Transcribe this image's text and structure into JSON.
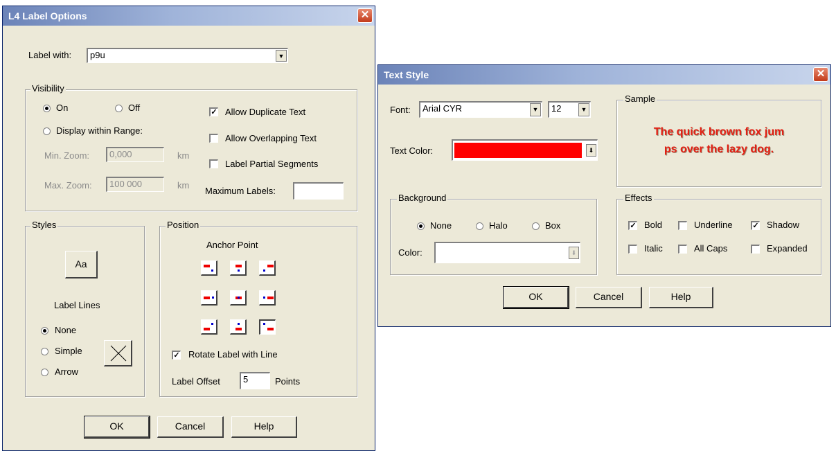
{
  "label_dialog": {
    "title": "L4 Label Options",
    "close_glyph": "✕",
    "label_with_label": "Label with:",
    "label_with_value": "p9u",
    "visibility": {
      "legend": "Visibility",
      "on_label": "On",
      "on_selected": true,
      "off_label": "Off",
      "off_selected": false,
      "range_label": "Display within Range:",
      "range_selected": false,
      "min_zoom_label": "Min. Zoom:",
      "min_zoom_value": "0,000",
      "min_unit": "km",
      "max_zoom_label": "Max. Zoom:",
      "max_zoom_value": "100 000",
      "max_unit": "km",
      "allow_duplicate_label": "Allow Duplicate Text",
      "allow_duplicate_checked": true,
      "allow_overlap_label": "Allow Overlapping Text",
      "allow_overlap_checked": false,
      "partial_segments_label": "Label Partial Segments",
      "partial_segments_checked": false,
      "max_labels_label": "Maximum Labels:",
      "max_labels_value": ""
    },
    "styles": {
      "legend": "Styles",
      "aa_button": "Aa",
      "label_lines_heading": "Label Lines",
      "none_label": "None",
      "none_selected": true,
      "simple_label": "Simple",
      "simple_selected": false,
      "arrow_label": "Arrow",
      "arrow_selected": false
    },
    "position": {
      "legend": "Position",
      "anchor_heading": "Anchor Point",
      "rotate_label": "Rotate Label with Line",
      "rotate_checked": true,
      "offset_label": "Label Offset",
      "offset_value": "5",
      "offset_unit": "Points"
    },
    "ok": "OK",
    "cancel": "Cancel",
    "help": "Help"
  },
  "text_dialog": {
    "title": "Text Style",
    "close_glyph": "✕",
    "font_label": "Font:",
    "font_value": "Arial CYR",
    "size_value": "12",
    "text_color_label": "Text Color:",
    "text_color": "#ff0000",
    "sample_legend": "Sample",
    "sample_text": "The quick brown fox jum ps over the lazy dog.",
    "sample_line1": "The quick brown fox jum",
    "sample_line2": "ps over the lazy dog.",
    "background": {
      "legend": "Background",
      "none_label": "None",
      "none_selected": true,
      "halo_label": "Halo",
      "halo_selected": false,
      "box_label": "Box",
      "box_selected": false,
      "color_label": "Color:"
    },
    "effects": {
      "legend": "Effects",
      "bold_label": "Bold",
      "bold_checked": true,
      "underline_label": "Underline",
      "underline_checked": false,
      "shadow_label": "Shadow",
      "shadow_checked": true,
      "italic_label": "Italic",
      "italic_checked": false,
      "allcaps_label": "All Caps",
      "allcaps_checked": false,
      "expanded_label": "Expanded",
      "expanded_checked": false
    },
    "ok": "OK",
    "cancel": "Cancel",
    "help": "Help"
  },
  "colors": {
    "title_start": "#6b83b8",
    "title_end": "#c8d5ec",
    "face": "#ece9d8",
    "sample_red": "#e41e12"
  }
}
